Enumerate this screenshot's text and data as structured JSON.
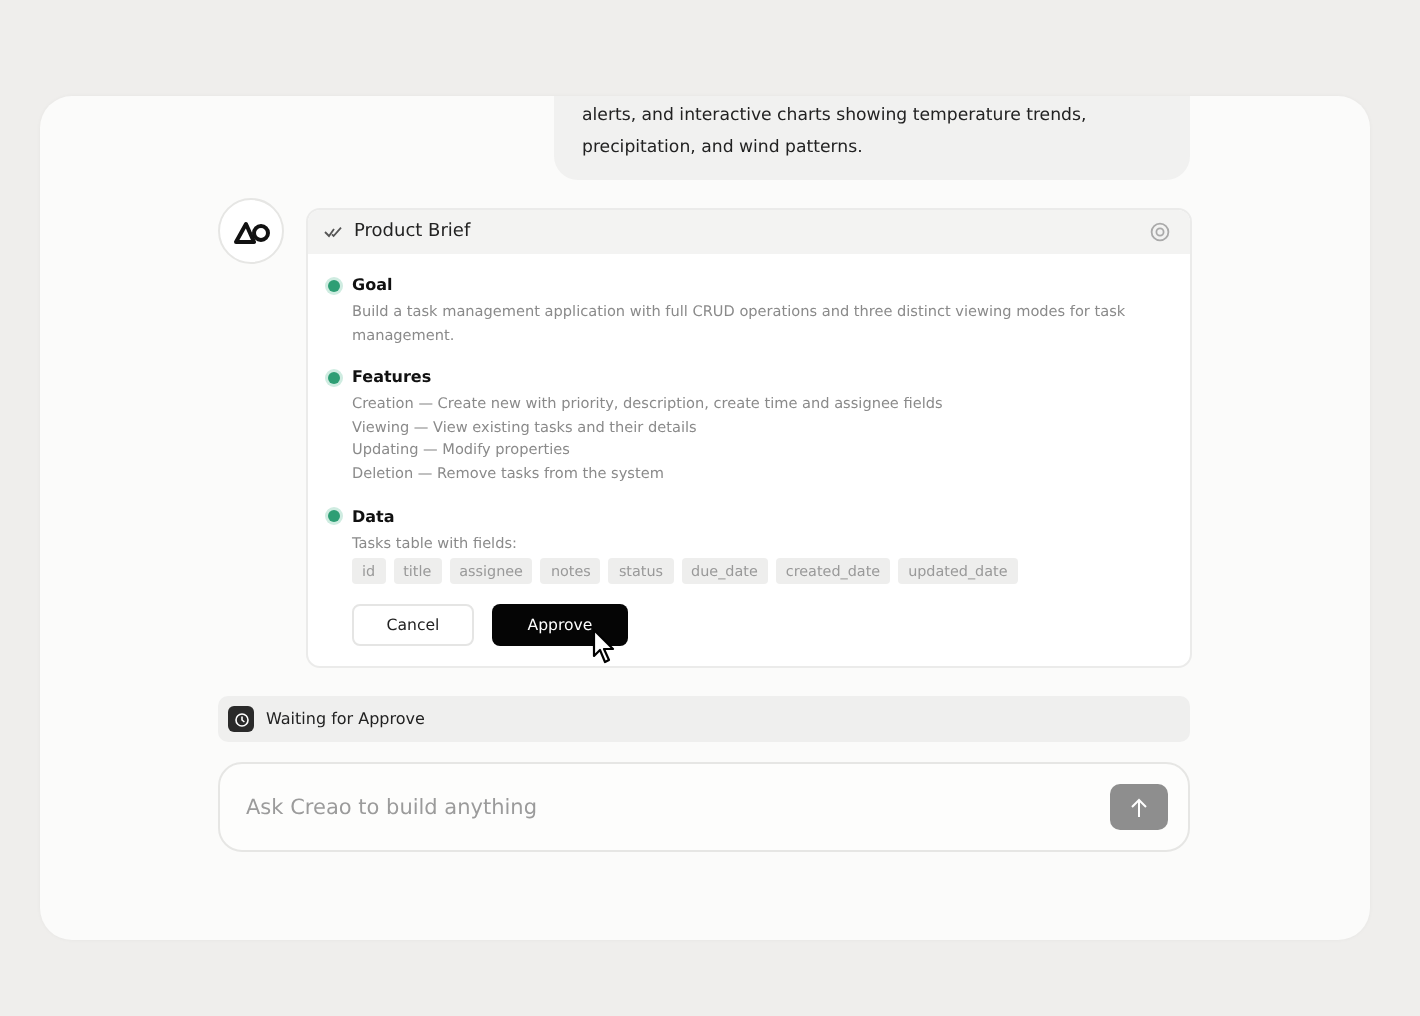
{
  "message": {
    "lines": [
      "alerts, and interactive charts showing temperature trends,",
      "precipitation, and wind patterns."
    ]
  },
  "brief": {
    "title": "Product Brief",
    "sections": [
      {
        "heading": "Goal",
        "kind": "text",
        "text": "Build a task management application with full CRUD operations and three distinct viewing modes for task management."
      },
      {
        "heading": "Features",
        "kind": "lines",
        "lines": [
          "Creation — Create new with priority, description, create time and assignee fields",
          "Viewing — View existing tasks and their details",
          "Updating — Modify properties",
          "Deletion — Remove tasks from the system"
        ]
      },
      {
        "heading": "Data",
        "kind": "tags",
        "text": "Tasks table with fields:",
        "tags": [
          "id",
          "title",
          "assignee",
          "notes",
          "status",
          "due_date",
          "created_date",
          "updated_date"
        ]
      }
    ],
    "buttons": [
      {
        "label": "Cancel",
        "kind": "secondary"
      },
      {
        "label": "Approve",
        "kind": "primary"
      }
    ]
  },
  "status": {
    "text": "Waiting for Approve"
  },
  "composer": {
    "placeholder": "Ask Creao to build anything"
  }
}
